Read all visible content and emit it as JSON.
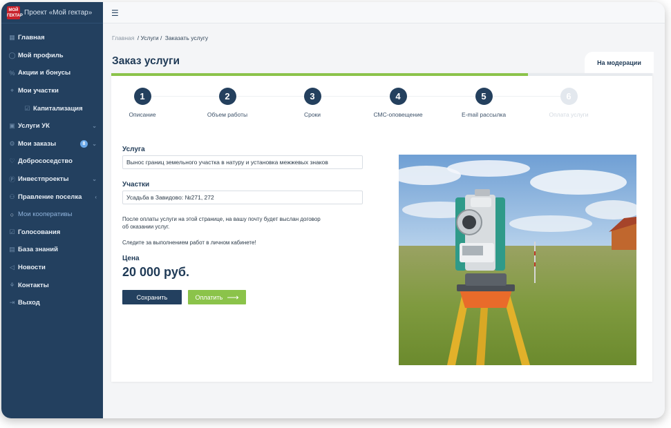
{
  "sidebar": {
    "logo_text": "МОЙ ГЕКТАР",
    "brand_title": "Проект «Мой гектар»",
    "items": [
      {
        "label": "Главная",
        "icon": "dashboard-icon"
      },
      {
        "label": "Мой профиль",
        "icon": "user-icon"
      },
      {
        "label": "Акции и бонусы",
        "icon": "percent-icon"
      },
      {
        "label": "Мои участки",
        "icon": "map-pin-icon"
      },
      {
        "label": "Капитализация",
        "icon": "check-square-icon"
      },
      {
        "label": "Услуги УК",
        "icon": "briefcase-icon"
      },
      {
        "label": "Мои заказы",
        "icon": "gear-icon",
        "badge": "8"
      },
      {
        "label": "Добрососедство",
        "icon": "handshake-icon"
      },
      {
        "label": "Инвестпроекты",
        "icon": "coin-icon"
      },
      {
        "label": "Правление поселка",
        "icon": "people-icon"
      },
      {
        "label": "Мои кооперативы",
        "icon": "circle-icon"
      },
      {
        "label": "Голосования",
        "icon": "ballot-icon"
      },
      {
        "label": "База знаний",
        "icon": "book-icon"
      },
      {
        "label": "Новости",
        "icon": "megaphone-icon"
      },
      {
        "label": "Контакты",
        "icon": "contacts-icon"
      },
      {
        "label": "Выход",
        "icon": "logout-icon"
      }
    ]
  },
  "breadcrumb": {
    "home": "Главная",
    "services": "/ Услуги /",
    "current": "Заказать услугу"
  },
  "page": {
    "title": "Заказ услуги",
    "status_tab": "На модерации",
    "progress_fraction": 0.77
  },
  "steps": [
    {
      "num": "1",
      "label": "Описание",
      "disabled": false
    },
    {
      "num": "2",
      "label": "Объем работы",
      "disabled": false
    },
    {
      "num": "3",
      "label": "Сроки",
      "disabled": false
    },
    {
      "num": "4",
      "label": "СМС-оповещение",
      "disabled": false
    },
    {
      "num": "5",
      "label": "E-mail рассылка",
      "disabled": false
    },
    {
      "num": "6",
      "label": "Оплата услуги",
      "disabled": true
    }
  ],
  "form": {
    "service_label": "Услуга",
    "service_value": "Вынос границ земельного участка в натуру и установка межжевых знаков",
    "plots_label": "Участки",
    "plots_value": "Усадьба в Завидово: №271, 272",
    "info_line1": "После оплаты услуги на этой странице, на вашу почту будет выслан договор",
    "info_line2": "об оказании услуг.",
    "info_line3": "Следите за выполнением работ в личном кабинете!",
    "price_label": "Цена",
    "price_value": "20 000 руб.",
    "save_button": "Сохранить",
    "pay_button": "Оплатить"
  },
  "colors": {
    "sidebar_bg": "#23405f",
    "accent_green": "#8bc34a",
    "step_active": "#24405e",
    "step_disabled": "#e3e8ee"
  }
}
